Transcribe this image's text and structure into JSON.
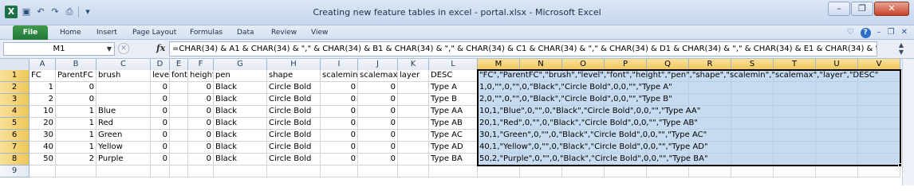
{
  "window": {
    "title": "Creating new feature tables in excel - portal.xlsx  -  Microsoft Excel",
    "app_icon": "X",
    "qat_icons": [
      "save-icon",
      "undo-icon",
      "redo-icon",
      "print-preview-icon"
    ],
    "controls": {
      "minimize": "–",
      "restore": "❐",
      "close": "✕"
    }
  },
  "ribbon": {
    "tabs": [
      "File",
      "Home",
      "Insert",
      "Page Layout",
      "Formulas",
      "Data",
      "Review",
      "View"
    ],
    "right_controls": {
      "collapse": "♡",
      "help": "?",
      "min": "–",
      "restore": "❐",
      "close": "✕"
    }
  },
  "formula_bar": {
    "name_box": "M1",
    "fx": "fx",
    "formula": "=CHAR(34) & A1 & CHAR(34) & \",\" & CHAR(34) & B1 & CHAR(34) & \",\" & CHAR(34) & C1 & CHAR(34) & \",\" & CHAR(34) & D1 & CHAR(34) & \",\" & CHAR(34) & E1 & CHAR(34) & \",\" &"
  },
  "sheet": {
    "columns": [
      "A",
      "B",
      "C",
      "D",
      "E",
      "F",
      "G",
      "H",
      "I",
      "J",
      "K",
      "L",
      "M",
      "N",
      "O",
      "P",
      "Q",
      "R",
      "S",
      "T",
      "U",
      "V"
    ],
    "selected_columns": [
      "M",
      "N",
      "O",
      "P",
      "Q",
      "R",
      "S",
      "T",
      "U",
      "V"
    ],
    "row_numbers": [
      "1",
      "2",
      "3",
      "4",
      "5",
      "6",
      "7",
      "8",
      "9"
    ],
    "selected_rows": [
      "1",
      "2",
      "3",
      "4",
      "5",
      "6",
      "7",
      "8"
    ],
    "rows": [
      [
        "FC",
        "ParentFC",
        "brush",
        "level",
        "font",
        "height",
        "pen",
        "shape",
        "scalemin",
        "scalemax",
        "layer",
        "DESC"
      ],
      [
        "1",
        "0",
        "",
        "0",
        "",
        "0",
        "Black",
        "Circle Bold",
        "0",
        "0",
        "",
        "Type A"
      ],
      [
        "2",
        "0",
        "",
        "0",
        "",
        "0",
        "Black",
        "Circle Bold",
        "0",
        "0",
        "",
        "Type B"
      ],
      [
        "10",
        "1",
        "Blue",
        "0",
        "",
        "0",
        "Black",
        "Circle Bold",
        "0",
        "0",
        "",
        "Type AA"
      ],
      [
        "20",
        "1",
        "Red",
        "0",
        "",
        "0",
        "Black",
        "Circle Bold",
        "0",
        "0",
        "",
        "Type AB"
      ],
      [
        "30",
        "1",
        "Green",
        "0",
        "",
        "0",
        "Black",
        "Circle Bold",
        "0",
        "0",
        "",
        "Type AC"
      ],
      [
        "40",
        "1",
        "Yellow",
        "0",
        "",
        "0",
        "Black",
        "Circle Bold",
        "0",
        "0",
        "",
        "Type AD"
      ],
      [
        "50",
        "2",
        "Purple",
        "0",
        "",
        "0",
        "Black",
        "Circle Bold",
        "0",
        "0",
        "",
        "Type BA"
      ]
    ],
    "m_column": [
      "\"FC\",\"ParentFC\",\"brush\",\"level\",\"font\",\"height\",\"pen\",\"shape\",\"scalemin\",\"scalemax\",\"layer\",\"DESC\"",
      "1,0,\"\",0,\"\",0,\"Black\",\"Circle Bold\",0,0,\"\",\"Type A\"",
      "2,0,\"\",0,\"\",0,\"Black\",\"Circle Bold\",0,0,\"\",\"Type B\"",
      "10,1,\"Blue\",0,\"\",0,\"Black\",\"Circle Bold\",0,0,\"\",\"Type AA\"",
      "20,1,\"Red\",0,\"\",0,\"Black\",\"Circle Bold\",0,0,\"\",\"Type AB\"",
      "30,1,\"Green\",0,\"\",0,\"Black\",\"Circle Bold\",0,0,\"\",\"Type AC\"",
      "40,1,\"Yellow\",0,\"\",0,\"Black\",\"Circle Bold\",0,0,\"\",\"Type AD\"",
      "50,2,\"Purple\",0,\"\",0,\"Black\",\"Circle Bold\",0,0,\"\",\"Type BA\""
    ],
    "colors": {
      "selection_fill": "#c6dbef",
      "header_highlight": "#f6d27a",
      "file_tab": "#2a8a41"
    }
  }
}
